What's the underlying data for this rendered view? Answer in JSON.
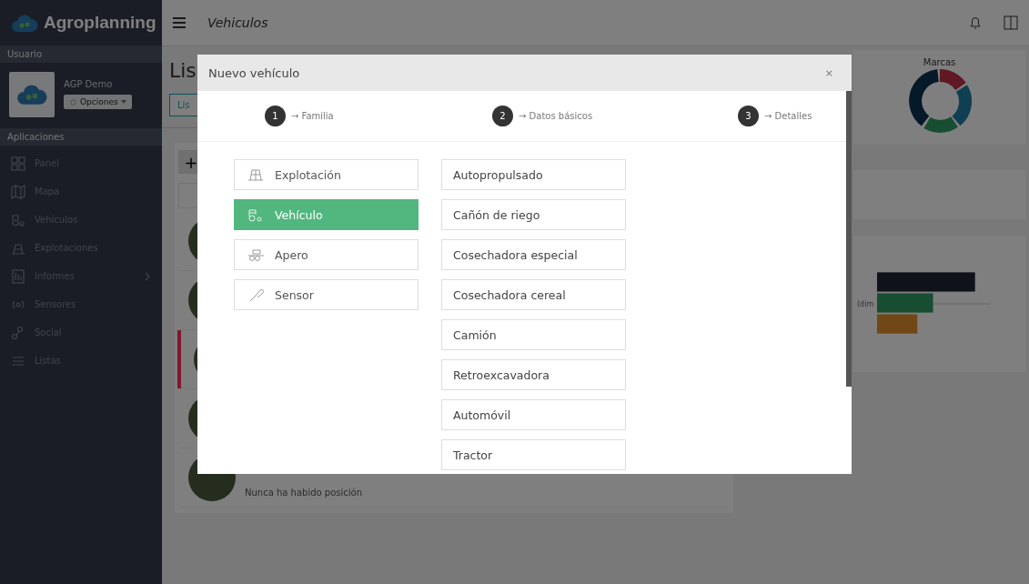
{
  "sidebar": {
    "brand": "Agroplanning",
    "user_section": "Usuario",
    "user_name": "AGP Demo",
    "options_button": "Opciones",
    "apps_section": "Aplicaciones",
    "items": [
      {
        "label": "Panel",
        "has_submenu": false
      },
      {
        "label": "Mapa",
        "has_submenu": false
      },
      {
        "label": "Vehículos",
        "has_submenu": false
      },
      {
        "label": "Explotaciones",
        "has_submenu": false
      },
      {
        "label": "Informes",
        "has_submenu": true
      },
      {
        "label": "Sensores",
        "has_submenu": false
      },
      {
        "label": "Social",
        "has_submenu": false
      },
      {
        "label": "Listas",
        "has_submenu": false
      }
    ]
  },
  "header": {
    "title": "Vehiculos"
  },
  "page": {
    "title": "Lis",
    "tab_button": "Lis",
    "add_button": "+",
    "rows": [
      {
        "highlighted": false
      },
      {
        "highlighted": false
      },
      {
        "highlighted": true
      },
      {
        "highlighted": false
      },
      {
        "text": "Nunca ha habido posición",
        "highlighted": false
      }
    ],
    "brands_card": {
      "title": "Marcas"
    },
    "bar_card": {
      "axis_label": "(dim"
    }
  },
  "modal": {
    "title": "Nuevo vehículo",
    "close": "×",
    "steps": [
      {
        "number": "1",
        "label": "→ Familia"
      },
      {
        "number": "2",
        "label": "→ Datos básicos"
      },
      {
        "number": "3",
        "label": "→ Detalles"
      }
    ],
    "families": [
      {
        "label": "Explotación",
        "selected": false
      },
      {
        "label": "Vehículo",
        "selected": true
      },
      {
        "label": "Apero",
        "selected": false
      },
      {
        "label": "Sensor",
        "selected": false
      }
    ],
    "types": [
      "Autopropulsado",
      "Cañón de riego",
      "Cosechadora especial",
      "Cosechadora cereal",
      "Camión",
      "Retroexcavadora",
      "Automóvil",
      "Tractor"
    ]
  }
}
